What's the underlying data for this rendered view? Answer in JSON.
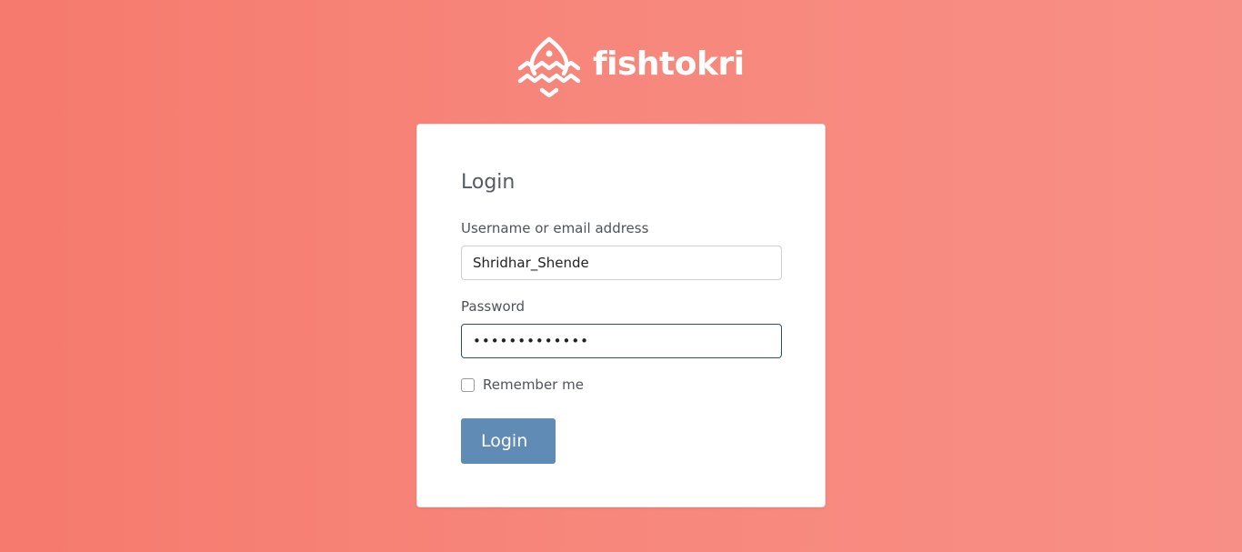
{
  "brand": {
    "name": "fishtokri",
    "logo_icon": "fish-waves-logo-icon"
  },
  "login_form": {
    "title": "Login",
    "username": {
      "label": "Username or email address",
      "value": "Shridhar_Shende"
    },
    "password": {
      "label": "Password",
      "value": "•••••••••••••"
    },
    "remember_me": {
      "label": "Remember me",
      "checked": false
    },
    "submit_label": "Login"
  },
  "colors": {
    "background_start": "#f67a6d",
    "background_end": "#f88f86",
    "button": "#608bb5",
    "focus_border": "#2c4f6a"
  }
}
